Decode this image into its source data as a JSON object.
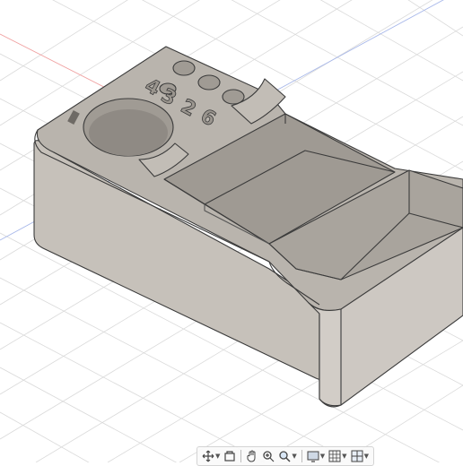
{
  "app": {
    "name": "Fusion 360 3D viewport"
  },
  "model": {
    "embossed_text": [
      "4",
      "3",
      "2",
      "6"
    ],
    "colors": {
      "body_side": "#c9c4bd",
      "body_top": "#b7b2ab",
      "cavity": "#a8a39c",
      "edge": "#3a3a3a",
      "grid_line": "#d9d9d9",
      "axis_red": "#f08080",
      "axis_blue": "#8aa0e0"
    }
  },
  "toolbar": {
    "items": [
      {
        "name": "orbit-icon",
        "has_dropdown": true
      },
      {
        "name": "look-at-icon",
        "has_dropdown": false
      },
      {
        "name": "pan-hand-icon",
        "has_dropdown": false
      },
      {
        "name": "zoom-icon",
        "has_dropdown": false
      },
      {
        "name": "zoom-window-icon",
        "has_dropdown": true
      },
      {
        "name": "display-settings-icon",
        "has_dropdown": true
      },
      {
        "name": "grid-icon",
        "has_dropdown": true
      },
      {
        "name": "viewports-icon",
        "has_dropdown": true
      }
    ]
  }
}
